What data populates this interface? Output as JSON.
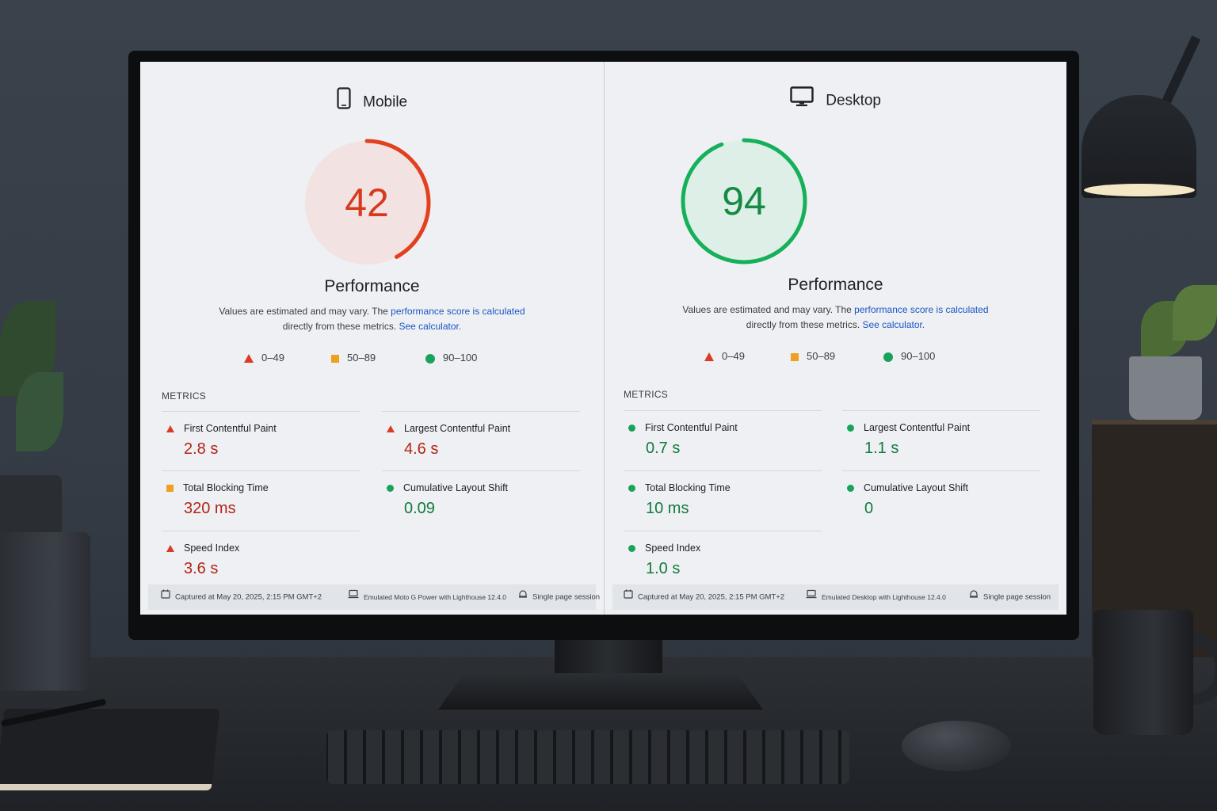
{
  "colors": {
    "fail": "#dc3a22",
    "average": "#f0a020",
    "pass": "#19a35a",
    "link": "#1a56c4"
  },
  "legend": {
    "fail_range": "0–49",
    "average_range": "50–89",
    "pass_range": "90–100"
  },
  "mobile": {
    "device_label": "Mobile",
    "device_icon": "smartphone-icon",
    "score": "42",
    "score_value": 42,
    "category_title": "Performance",
    "note_text": "Values are estimated and may vary. The ",
    "note_link": "performance score is calculated",
    "note_text2": "directly from these metrics. ",
    "note_link2": "See calculator.",
    "metrics_title": "METRICS",
    "metrics": [
      {
        "label": "First Contentful Paint",
        "value": "2.8 s",
        "status": "fail"
      },
      {
        "label": "Largest Contentful Paint",
        "value": "4.6 s",
        "status": "fail"
      },
      {
        "label": "Total Blocking Time",
        "value": "320 ms",
        "status": "average"
      },
      {
        "label": "Cumulative Layout Shift",
        "value": "0.09",
        "status": "pass"
      },
      {
        "label": "Speed Index",
        "value": "3.6 s",
        "status": "fail"
      }
    ],
    "footer": {
      "captured": "Captured at May 20, 2025, 2:15 PM GMT+2",
      "emulated": "Emulated Moto G Power with Lighthouse 12.4.0",
      "session": "Single page session"
    }
  },
  "desktop": {
    "device_label": "Desktop",
    "device_icon": "desktop-monitor-icon",
    "score": "94",
    "score_value": 94,
    "category_title": "Performance",
    "note_text": "Values are estimated and may vary. The ",
    "note_link": "performance score is calculated",
    "note_text2": "directly from these metrics. ",
    "note_link2": "See calculator.",
    "metrics_title": "METRICS",
    "metrics": [
      {
        "label": "First Contentful Paint",
        "value": "0.7 s",
        "status": "pass"
      },
      {
        "label": "Largest Contentful Paint",
        "value": "1.1 s",
        "status": "pass"
      },
      {
        "label": "Total Blocking Time",
        "value": "10 ms",
        "status": "pass"
      },
      {
        "label": "Cumulative Layout Shift",
        "value": "0",
        "status": "pass"
      },
      {
        "label": "Speed Index",
        "value": "1.0 s",
        "status": "pass"
      }
    ],
    "footer": {
      "captured": "Captured at May 20, 2025, 2:15 PM GMT+2",
      "emulated": "Emulated Desktop with Lighthouse 12.4.0",
      "session": "Single page session"
    }
  }
}
